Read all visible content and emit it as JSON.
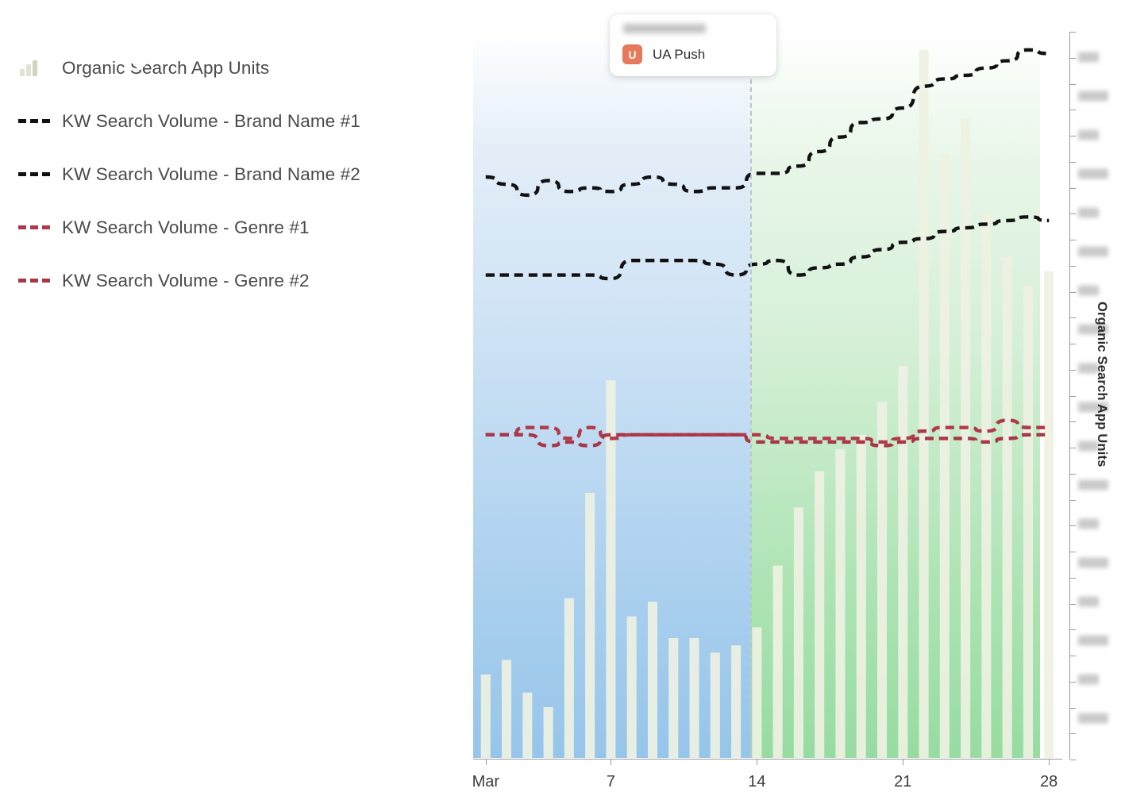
{
  "legend": {
    "items": [
      {
        "label": "Organic Search App Units",
        "key": "bars-icon",
        "color": "#eef1e2",
        "style": "bar"
      },
      {
        "label": "KW Search Volume - Brand Name #1",
        "key": "dash-icon",
        "color": "#111111",
        "style": "dashed"
      },
      {
        "label": "KW Search Volume - Brand Name #2",
        "key": "dash-icon",
        "color": "#111111",
        "style": "dashed"
      },
      {
        "label": "KW Search Volume - Genre #1",
        "key": "dash-icon",
        "color": "#b03a4a",
        "style": "dashed"
      },
      {
        "label": "KW Search Volume - Genre #2",
        "key": "dash-icon",
        "color": "#a93545",
        "style": "dashed"
      }
    ]
  },
  "tooltip": {
    "date_redacted": "",
    "event_icon": "ua-push-icon",
    "event_icon_letter": "U",
    "event_label": "UA Push",
    "icon_color": "#e8795a"
  },
  "axes": {
    "y_right_title": "Organic Search App Units",
    "y_tick_labels_redacted": true,
    "x_tick_labels": [
      "Mar",
      "7",
      "14",
      "21",
      "28"
    ],
    "x_tick_days": [
      1,
      7,
      14,
      21,
      28
    ]
  },
  "chart_data": {
    "type": "bar",
    "title": "",
    "xlabel": "",
    "ylabel": "Organic Search App Units",
    "grid": false,
    "legend_position": "left",
    "xlim": [
      0.4,
      28.6
    ],
    "ylim": [
      0,
      100
    ],
    "x": [
      1,
      2,
      3,
      4,
      5,
      6,
      7,
      8,
      9,
      10,
      11,
      12,
      13,
      14,
      15,
      16,
      17,
      18,
      19,
      20,
      21,
      22,
      23,
      24,
      25,
      26,
      27,
      28
    ],
    "background_bands": [
      {
        "label": "before",
        "from_day": 1,
        "to_day": 13.5,
        "color": "#a9cfee"
      },
      {
        "label": "after",
        "from_day": 13.5,
        "to_day": 27.0,
        "color": "#abe3b2"
      }
    ],
    "marker_line": {
      "day": 13.5,
      "style": "dashed",
      "color": "#b9c4cd",
      "annotation": "UA Push"
    },
    "series": [
      {
        "name": "Organic Search App Units",
        "type": "bar",
        "color": "#eef1e2",
        "values": [
          11.5,
          13.5,
          9.0,
          7.0,
          22.0,
          36.5,
          52.0,
          19.5,
          21.5,
          16.5,
          16.5,
          14.5,
          15.5,
          18.0,
          26.5,
          34.5,
          39.5,
          42.5,
          44.5,
          49.0,
          54.0,
          97.5,
          83.0,
          88.0,
          75.0,
          69.0,
          65.0,
          67.0
        ]
      },
      {
        "name": "KW Search Volume - Brand Name #1",
        "type": "line",
        "style": "dashed",
        "color": "#111111",
        "values": [
          80.0,
          79.0,
          77.5,
          79.5,
          78.0,
          78.5,
          78.0,
          79.0,
          80.0,
          79.0,
          78.0,
          78.5,
          78.5,
          80.5,
          80.5,
          81.5,
          83.5,
          85.5,
          87.5,
          88.0,
          89.5,
          92.5,
          93.5,
          94.0,
          95.0,
          96.0,
          97.5,
          97.0
        ]
      },
      {
        "name": "KW Search Volume - Brand Name #2",
        "type": "line",
        "style": "dashed",
        "color": "#111111",
        "values": [
          66.5,
          66.5,
          66.5,
          66.5,
          66.5,
          66.5,
          66.0,
          68.5,
          68.5,
          68.5,
          68.5,
          68.0,
          66.5,
          68.0,
          68.5,
          66.5,
          67.5,
          68.0,
          69.0,
          70.0,
          71.0,
          71.5,
          72.5,
          73.0,
          73.5,
          74.0,
          74.5,
          74.0
        ]
      },
      {
        "name": "KW Search Volume - Genre #1",
        "type": "line",
        "style": "dashed",
        "color": "#b03a4a",
        "values": [
          44.5,
          44.5,
          45.5,
          45.5,
          44.0,
          45.5,
          44.0,
          44.5,
          44.5,
          44.5,
          44.5,
          44.5,
          44.5,
          44.5,
          44.0,
          44.0,
          44.0,
          44.0,
          44.0,
          43.5,
          44.0,
          45.0,
          45.5,
          45.5,
          45.0,
          46.5,
          45.5,
          45.5
        ]
      },
      {
        "name": "KW Search Volume - Genre #2",
        "type": "line",
        "style": "dashed",
        "color": "#a93545",
        "values": [
          44.5,
          44.5,
          44.5,
          43.0,
          43.5,
          43.0,
          44.5,
          44.5,
          44.5,
          44.5,
          44.5,
          44.5,
          44.5,
          43.5,
          43.5,
          43.5,
          43.5,
          43.5,
          43.5,
          43.0,
          43.5,
          44.0,
          44.0,
          44.0,
          43.5,
          44.0,
          44.5,
          44.5
        ]
      }
    ]
  }
}
